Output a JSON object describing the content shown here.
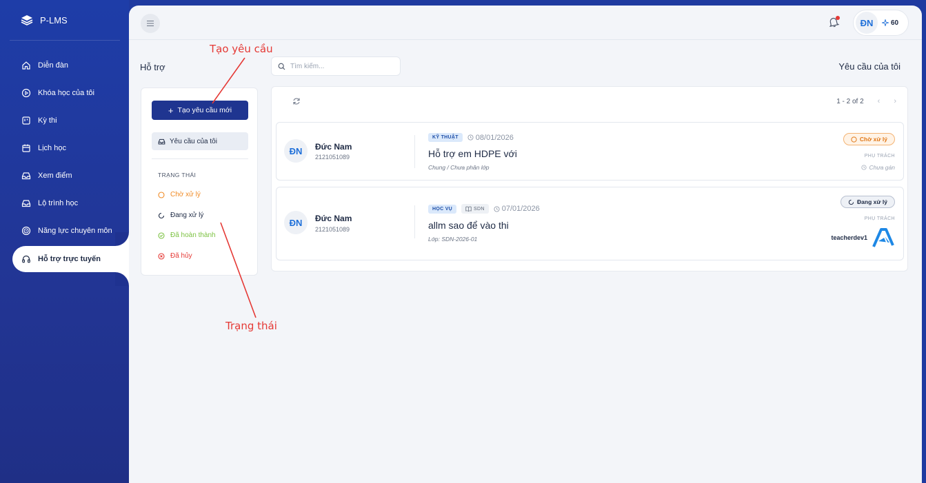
{
  "brand": {
    "name": "P-LMS"
  },
  "sidebar": {
    "items": [
      {
        "label": "Diễn đàn",
        "icon": "home-icon"
      },
      {
        "label": "Khóa học của tôi",
        "icon": "play-circle-icon"
      },
      {
        "label": "Kỳ thi",
        "icon": "exam-board-icon"
      },
      {
        "label": "Lịch học",
        "icon": "calendar-icon"
      },
      {
        "label": "Xem điểm",
        "icon": "inbox-icon"
      },
      {
        "label": "Lộ trình học",
        "icon": "inbox-icon"
      },
      {
        "label": "Năng lực chuyên môn",
        "icon": "target-icon"
      },
      {
        "label": "Hỗ trợ trực tuyến",
        "icon": "headset-icon",
        "active": true
      }
    ]
  },
  "topbar": {
    "user_initials": "ĐN",
    "points": "60"
  },
  "page": {
    "title": "Hỗ trợ",
    "search_placeholder": "Tìm kiếm...",
    "right_title": "Yêu cầu của tôi"
  },
  "filters": {
    "new_request": "Tạo yêu cầu mới",
    "my_requests": "Yêu cầu của tôi",
    "status_heading": "TRẠNG THÁI",
    "statuses": [
      {
        "label": "Chờ xử lý",
        "color": "#f08a24"
      },
      {
        "label": "Đang xử lý",
        "color": "#1e2a44"
      },
      {
        "label": "Đã hoàn thành",
        "color": "#7cc242"
      },
      {
        "label": "Đã hủy",
        "color": "#e53935"
      }
    ]
  },
  "list": {
    "pagination": "1 - 2 of 2",
    "requests": [
      {
        "initials": "ĐN",
        "name": "Đức Nam",
        "student_id": "2121051089",
        "tags": [
          "KỸ THUẬT"
        ],
        "date": "08/01/2026",
        "title": "Hỗ trợ em HDPE với",
        "subtitle": "Chung / Chưa phân lớp",
        "status": "Chờ xử lý",
        "assignee_label": "PHỤ TRÁCH",
        "assignee": "Chưa gán"
      },
      {
        "initials": "ĐN",
        "name": "Đức Nam",
        "student_id": "2121051089",
        "tags": [
          "HỌC VỤ",
          "SDN"
        ],
        "date": "07/01/2026",
        "title": "allm sao để vào thi",
        "subtitle": "Lớp: SDN-2026-01",
        "status": "Đang xử lý",
        "assignee_label": "PHỤ TRÁCH",
        "assignee": "teacherdev1"
      }
    ]
  },
  "annotations": {
    "create_request": "Tạo yêu cầu",
    "status": "Trạng thái"
  },
  "colors": {
    "sidebar": "#1f3590",
    "primary": "#1f3590",
    "annotation": "#e53935"
  }
}
